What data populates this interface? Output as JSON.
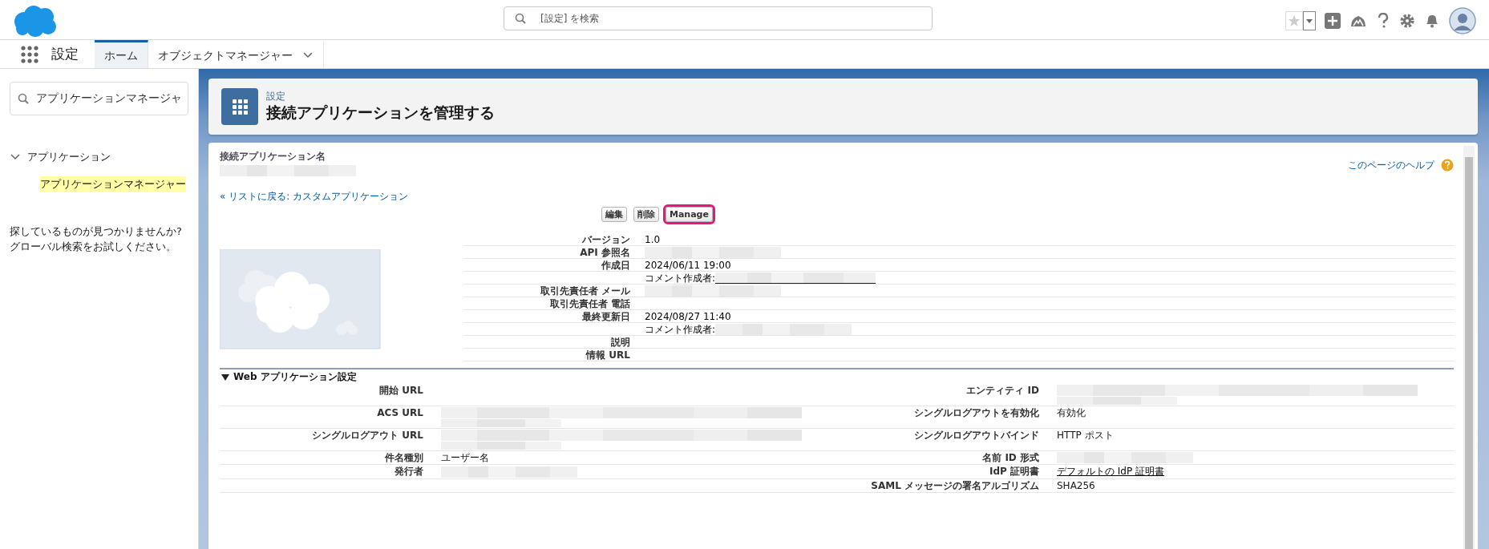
{
  "app_header": {
    "search": {
      "placeholder": "[設定] を検索"
    }
  },
  "nav": {
    "app_name": "設定",
    "tabs": [
      {
        "label": "ホーム",
        "selected": true,
        "dropdown": false
      },
      {
        "label": "オブジェクトマネージャー",
        "selected": false,
        "dropdown": true
      }
    ]
  },
  "sidebar": {
    "search": {
      "value": "アプリケーションマネージャ"
    },
    "tree": [
      {
        "label": "アプリケーション",
        "expanded": true,
        "selected": false,
        "children": [
          {
            "label": "アプリケーションマネージャー",
            "selected": true
          }
        ]
      }
    ],
    "help_text": "探しているものが見つかりませんか?\nグローバル検索をお試しください。"
  },
  "page_header": {
    "breadcrumb": "設定",
    "title": "接続アプリケーションを管理する"
  },
  "detail": {
    "name_label": "接続アプリケーション名",
    "name_redacted": true,
    "help_link": "このページのヘルプ",
    "back_link": "« リストに戻る: カスタムアプリケーション",
    "buttons": [
      {
        "label": "編集",
        "highlighted": false
      },
      {
        "label": "削除",
        "highlighted": false
      },
      {
        "label": "Manage",
        "highlighted": true
      }
    ],
    "fields": [
      {
        "label": "バージョン",
        "value": "1.0"
      },
      {
        "label": "API 参照名",
        "redacted": true
      },
      {
        "label": "作成日",
        "value": "2024/06/11 19:00"
      },
      {
        "prefix": "コメント作成者:",
        "redacted": true,
        "link": true
      },
      {
        "label": "取引先責任者 メール",
        "redacted": true
      },
      {
        "label": "取引先責任者 電話"
      },
      {
        "label": "最終更新日",
        "value": "2024/08/27 11:40"
      },
      {
        "prefix": "コメント作成者:",
        "redacted": true,
        "link": false
      },
      {
        "label": "説明"
      },
      {
        "label": "情報 URL"
      }
    ],
    "sections": [
      {
        "title": "Web アプリケーション設定",
        "expanded": true,
        "rows": [
          [
            {
              "label": "開始 URL"
            },
            {
              "label": "エンティティ ID",
              "redacted": true,
              "multiline": true
            }
          ],
          [
            {
              "label": "ACS URL",
              "redacted": true,
              "multiline": true
            },
            {
              "label": "シングルログアウトを有効化",
              "value": "有効化",
              "link": false
            }
          ],
          [
            {
              "label": "シングルログアウト URL",
              "redacted": true,
              "multiline": true
            },
            {
              "label": "シングルログアウトバインド",
              "value": "HTTP ポスト",
              "link": false
            }
          ],
          [
            {
              "label": "件名種別",
              "value": "ユーザー名",
              "link": false
            },
            {
              "label": "名前 ID 形式",
              "redacted": true,
              "multiline": false
            }
          ],
          [
            {
              "label": "発行者",
              "redacted": true,
              "multiline": false
            },
            {
              "label": "IdP 証明書",
              "value": "デフォルトの IdP 証明書",
              "link": true
            }
          ],
          [
            {},
            {
              "label": "SAML メッセージの署名アルゴリズム",
              "value": "SHA256",
              "link": false
            }
          ]
        ]
      }
    ]
  }
}
